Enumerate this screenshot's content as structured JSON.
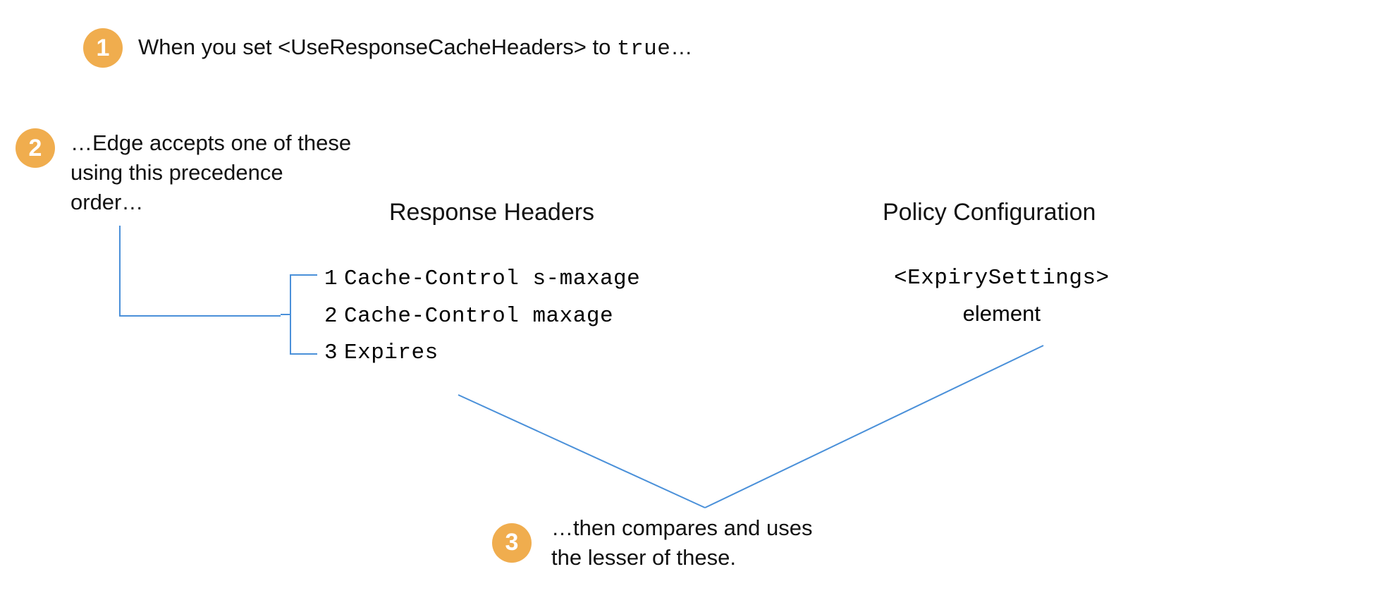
{
  "steps": {
    "s1": {
      "num": "1",
      "text_a": "When you set ",
      "tag": "<UseResponseCacheHeaders>",
      "text_b": " to ",
      "val": "true",
      "text_c": "…"
    },
    "s2": {
      "num": "2",
      "text": "…Edge accepts one of these using this precedence order…"
    },
    "s3": {
      "num": "3",
      "text": "…then compares and uses the lesser of these."
    }
  },
  "headings": {
    "response": "Response Headers",
    "policy": "Policy Configuration"
  },
  "headers": {
    "items": [
      {
        "num": "1",
        "name": "Cache-Control s-maxage"
      },
      {
        "num": "2",
        "name": "Cache-Control maxage"
      },
      {
        "num": "3",
        "name": "Expires"
      }
    ]
  },
  "policy": {
    "tag": "<ExpirySettings>",
    "word": "element"
  },
  "colors": {
    "badge": "#f0ad4e",
    "line": "#4a90d9"
  }
}
